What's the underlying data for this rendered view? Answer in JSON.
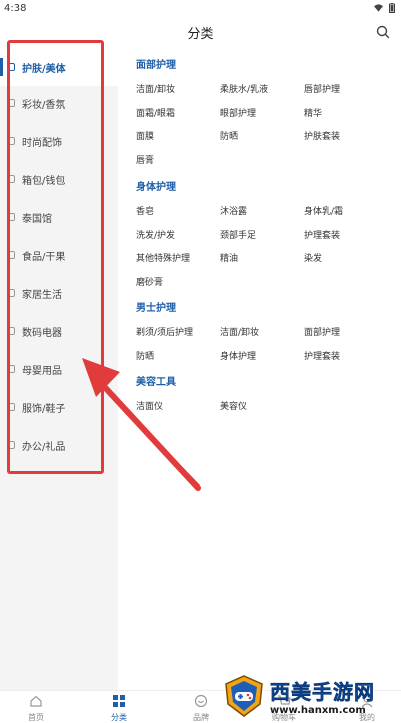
{
  "status_bar": {
    "time": "4:38"
  },
  "header": {
    "title": "分类"
  },
  "sidebar": {
    "items": [
      {
        "label": "护肤/美体",
        "active": true,
        "icon": "sparkle-icon"
      },
      {
        "label": "彩妆/香氛",
        "active": false,
        "icon": "lipstick-icon"
      },
      {
        "label": "时尚配饰",
        "active": false,
        "icon": "ring-icon"
      },
      {
        "label": "箱包/钱包",
        "active": false,
        "icon": "bag-icon"
      },
      {
        "label": "泰国馆",
        "active": false,
        "icon": "building-icon"
      },
      {
        "label": "食品/干果",
        "active": false,
        "icon": "food-icon"
      },
      {
        "label": "家居生活",
        "active": false,
        "icon": "home-icon"
      },
      {
        "label": "数码电器",
        "active": false,
        "icon": "device-icon"
      },
      {
        "label": "母婴用品",
        "active": false,
        "icon": "baby-icon"
      },
      {
        "label": "服饰/鞋子",
        "active": false,
        "icon": "shirt-icon"
      },
      {
        "label": "办公/礼品",
        "active": false,
        "icon": "gift-icon"
      }
    ]
  },
  "sections": [
    {
      "title": "面部护理",
      "items": [
        "洁面/卸妆",
        "柔肤水/乳液",
        "唇部护理",
        "面霜/眼霜",
        "眼部护理",
        "精华",
        "面膜",
        "防晒",
        "护肤套装",
        "唇膏"
      ]
    },
    {
      "title": "身体护理",
      "items": [
        "香皂",
        "沐浴露",
        "身体乳/霜",
        "洗发/护发",
        "颈部手足",
        "护理套装",
        "其他特殊护理",
        "精油",
        "染发",
        "磨砂膏"
      ]
    },
    {
      "title": "男士护理",
      "items": [
        "剃须/须后护理",
        "洁面/卸妆",
        "面部护理",
        "防晒",
        "身体护理",
        "护理套装"
      ]
    },
    {
      "title": "美容工具",
      "items": [
        "洁面仪",
        "美容仪"
      ]
    }
  ],
  "bottom_nav": [
    {
      "label": "首页",
      "icon": "home-icon",
      "active": false
    },
    {
      "label": "分类",
      "icon": "grid-icon",
      "active": true
    },
    {
      "label": "品牌",
      "icon": "brand-icon",
      "active": false
    },
    {
      "label": "购物车",
      "icon": "cart-icon",
      "active": false
    },
    {
      "label": "我的",
      "icon": "user-icon",
      "active": false
    }
  ],
  "watermark": {
    "title": "西美手游网",
    "url": "www.hanxm.com"
  },
  "colors": {
    "accent": "#1f5fa8",
    "annotation": "#e23b3b",
    "sidebar_bg": "#f4f4f4"
  }
}
